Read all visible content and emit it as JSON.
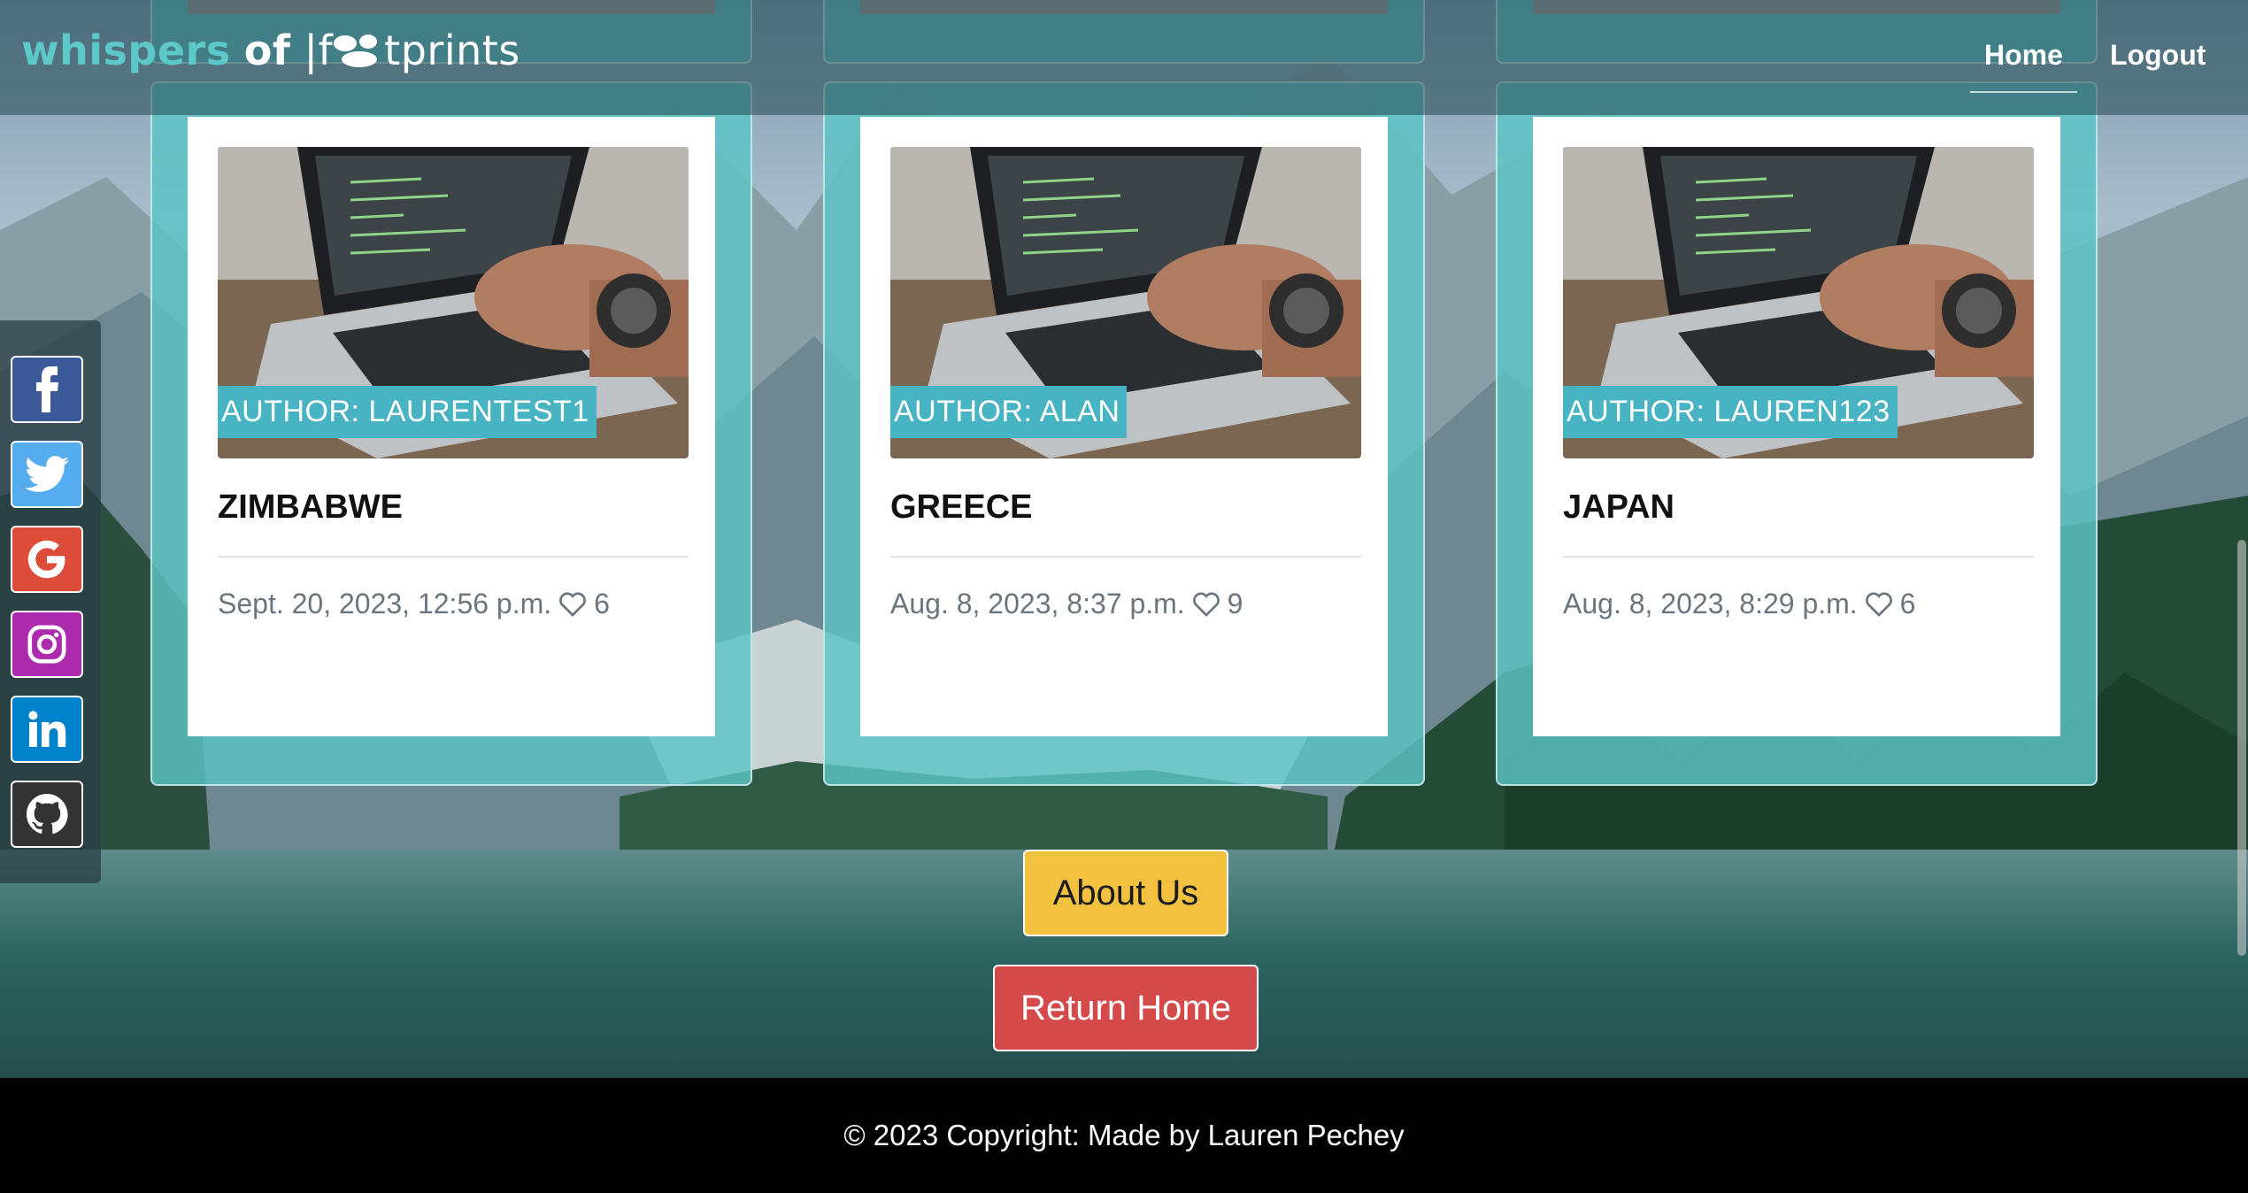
{
  "navbar": {
    "brand": {
      "part1": "whispers",
      "part2": "of",
      "part3": "|f",
      "part4": "tprints"
    },
    "links": [
      {
        "label": "Home"
      },
      {
        "label": "Logout"
      }
    ]
  },
  "social": [
    {
      "icon": "facebook-icon",
      "color": "#3b5998"
    },
    {
      "icon": "twitter-icon",
      "color": "#55acee"
    },
    {
      "icon": "google-icon",
      "color": "#dd4b39"
    },
    {
      "icon": "instagram-icon",
      "color": "#ac2bac"
    },
    {
      "icon": "linkedin-icon",
      "color": "#0082ca"
    },
    {
      "icon": "github-icon",
      "color": "#333333"
    }
  ],
  "cards": [
    {
      "author": "AUTHOR: LAURENTEST1",
      "title": "ZIMBABWE",
      "date": "Sept. 20, 2023, 12:56 p.m.",
      "likes": "6"
    },
    {
      "author": "AUTHOR: ALAN",
      "title": "GREECE",
      "date": "Aug. 8, 2023, 8:37 p.m.",
      "likes": "9"
    },
    {
      "author": "AUTHOR: LAUREN123",
      "title": "JAPAN",
      "date": "Aug. 8, 2023, 8:29 p.m.",
      "likes": "6"
    }
  ],
  "buttons": {
    "about": "About Us",
    "return_home": "Return Home"
  },
  "footer": {
    "text": "© 2023 Copyright: Made by Lauren Pechey"
  },
  "colors": {
    "brand_teal": "#5cc8c8",
    "author_badge": "#48b3c3",
    "about_button": "#f2c140",
    "home_button": "#d44a4a"
  }
}
